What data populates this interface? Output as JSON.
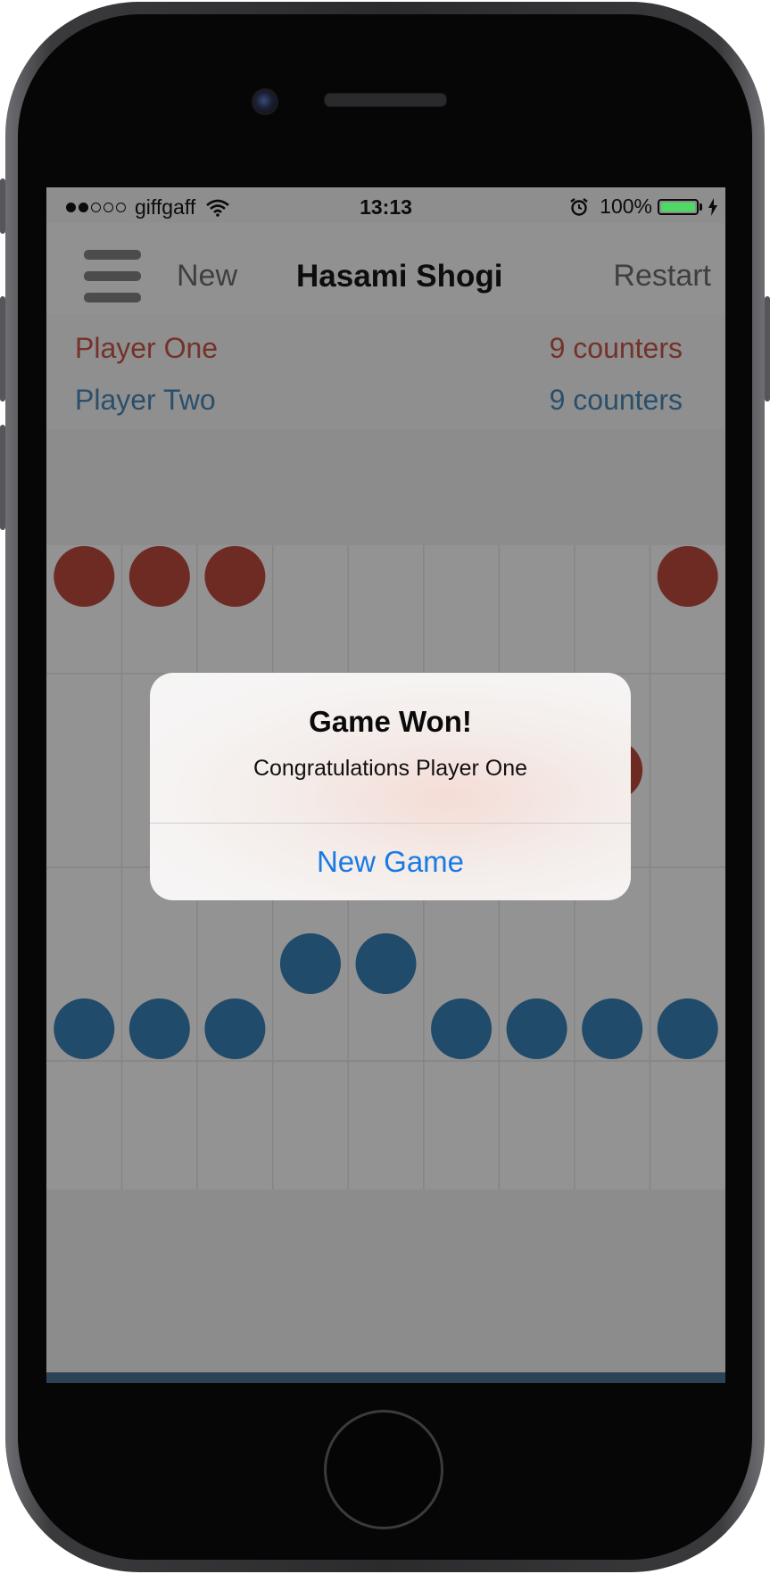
{
  "status_bar": {
    "carrier": "giffgaff",
    "signal_strength": 2,
    "signal_max": 5,
    "time": "13:13",
    "battery_percent": "100%",
    "battery_level": 1.0
  },
  "navbar": {
    "menu_icon": "hamburger-menu-icon",
    "new_label": "New",
    "title": "Hasami Shogi",
    "restart_label": "Restart"
  },
  "players": [
    {
      "name": "Player One",
      "counters": "9 counters",
      "color": "#74322a"
    },
    {
      "name": "Player Two",
      "counters": "9 counters",
      "color": "#2a4f6c"
    }
  ],
  "board": {
    "columns": 9,
    "red_color": "#6e2b23",
    "blue_color": "#214b6a",
    "red_pieces": [
      {
        "row": 1,
        "col": 1
      },
      {
        "row": 1,
        "col": 2
      },
      {
        "row": 1,
        "col": 3
      },
      {
        "row": 1,
        "col": 9
      },
      {
        "row": 4,
        "col": 8
      }
    ],
    "blue_pieces": [
      {
        "row": 7,
        "col": 4
      },
      {
        "row": 7,
        "col": 5
      },
      {
        "row": 8,
        "col": 1
      },
      {
        "row": 8,
        "col": 2
      },
      {
        "row": 8,
        "col": 3
      },
      {
        "row": 8,
        "col": 6
      },
      {
        "row": 8,
        "col": 7
      },
      {
        "row": 8,
        "col": 8
      },
      {
        "row": 8,
        "col": 9
      }
    ]
  },
  "alert": {
    "title": "Game Won!",
    "message": "Congratulations Player One",
    "button_label": "New Game"
  },
  "colors": {
    "accent_blue": "#1a7ae3",
    "battery_green": "#4cd964"
  }
}
